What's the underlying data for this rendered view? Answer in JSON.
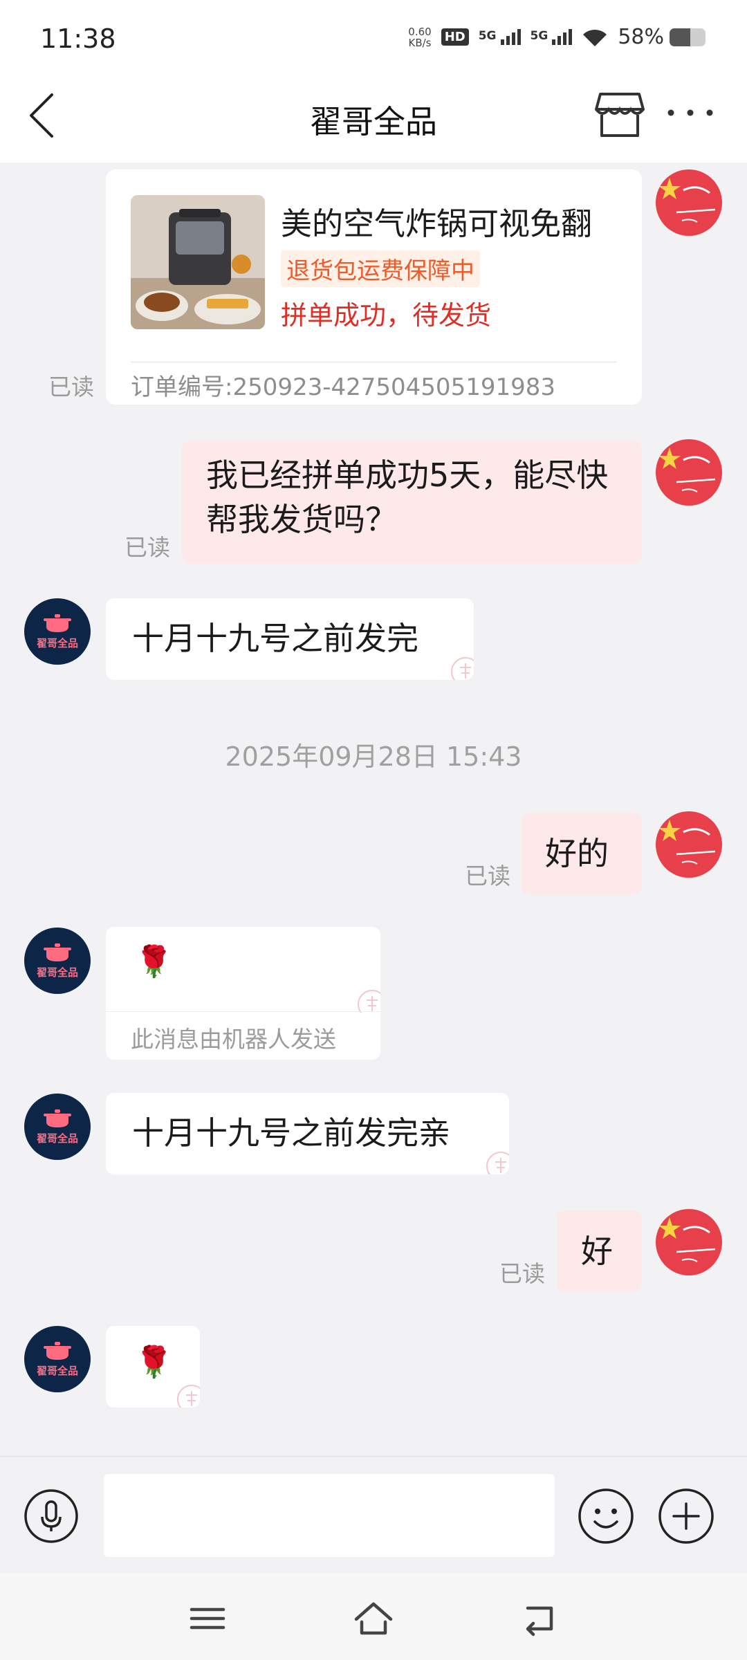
{
  "status_bar": {
    "time": "11:38",
    "net_speed_value": "0.60",
    "net_speed_unit": "KB/s",
    "hd_label": "HD",
    "sim1_label": "5G",
    "sim2_label": "5G",
    "battery_percent": "58%",
    "battery_level": 0.58
  },
  "header": {
    "title": "翟哥全品",
    "back_icon": "chevron-left-icon",
    "store_icon": "store-icon",
    "more_icon": "more-dots-icon"
  },
  "shop": {
    "avatar_name": "翟哥全品",
    "avatar_color": "#0d2547",
    "avatar_text_color": "#ff6c82"
  },
  "messages": {
    "order_card": {
      "product_name": "美的空气炸锅可视免翻",
      "tag": "退货包运费保障中",
      "status": "拼单成功，待发货",
      "order_no": "订单编号:250923-427504505191983",
      "read": "已读"
    },
    "m1": {
      "text": "我已经拼单成功5天，能尽快帮我发货吗？",
      "read": "已读"
    },
    "m2": {
      "text": "十月十九号之前发完"
    },
    "timestamp": "2025年09月28日 15:43",
    "m3": {
      "text": "好的",
      "read": "已读"
    },
    "m4": {
      "emoji": "🌹",
      "note": "此消息由机器人发送"
    },
    "m5": {
      "text": "十月十九号之前发完亲"
    },
    "m6": {
      "text": "好",
      "read": "已读"
    },
    "m7": {
      "emoji": "🌹"
    }
  },
  "input_bar": {
    "placeholder": "",
    "voice_icon": "microphone-icon",
    "emoji_icon": "smiley-icon",
    "plus_icon": "plus-circle-icon"
  },
  "nav": {
    "menu_icon": "menu-icon",
    "home_icon": "home-icon",
    "back_icon": "back-icon"
  },
  "colors": {
    "accent_red": "#e02e24",
    "tag_orange": "#f05a28",
    "bubble_pink": "#fde9ea",
    "background": "#f2f2f4"
  }
}
